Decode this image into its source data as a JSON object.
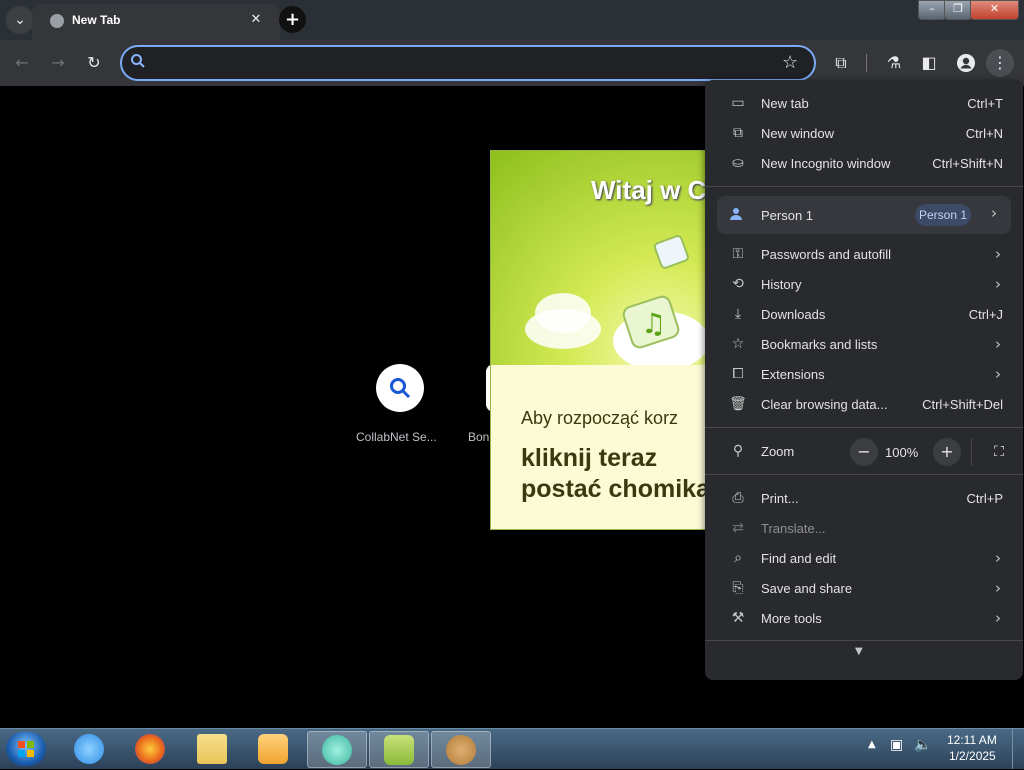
{
  "tab": {
    "title": "New Tab",
    "close": "✕"
  },
  "window_controls": {
    "minimize": "–",
    "maximize": "❐",
    "close": "✕"
  },
  "omnibox": {
    "value": "",
    "placeholder": ""
  },
  "shortcuts": [
    {
      "label": "CollabNet Se...",
      "icon": "search-icon"
    },
    {
      "label": "Boni",
      "icon": "bookmark-icon"
    }
  ],
  "popup": {
    "title": "Witaj w Ch",
    "line1": "Aby rozpocząć korz",
    "line2": "kliknij teraz",
    "line3": "postać chomika"
  },
  "menu": {
    "items_top": [
      {
        "label": "New tab",
        "shortcut": "Ctrl+T",
        "icon": "new-tab-icon"
      },
      {
        "label": "New window",
        "shortcut": "Ctrl+N",
        "icon": "new-window-icon"
      },
      {
        "label": "New Incognito window",
        "shortcut": "Ctrl+Shift+N",
        "icon": "incognito-icon"
      }
    ],
    "person": {
      "label": "Person 1",
      "badge": "Person 1"
    },
    "items_mid": [
      {
        "label": "Passwords and autofill",
        "shortcut": "",
        "submenu": true,
        "icon": "key-icon"
      },
      {
        "label": "History",
        "shortcut": "",
        "submenu": true,
        "icon": "history-icon"
      },
      {
        "label": "Downloads",
        "shortcut": "Ctrl+J",
        "submenu": false,
        "icon": "download-icon"
      },
      {
        "label": "Bookmarks and lists",
        "shortcut": "",
        "submenu": true,
        "icon": "star-icon"
      },
      {
        "label": "Extensions",
        "shortcut": "",
        "submenu": true,
        "icon": "puzzle-icon"
      },
      {
        "label": "Clear browsing data...",
        "shortcut": "Ctrl+Shift+Del",
        "submenu": false,
        "icon": "trash-icon"
      }
    ],
    "zoom": {
      "label": "Zoom",
      "value": "100%",
      "minus": "−",
      "plus": "+"
    },
    "items_bottom": [
      {
        "label": "Print...",
        "shortcut": "Ctrl+P",
        "submenu": false,
        "disabled": false,
        "icon": "print-icon"
      },
      {
        "label": "Translate...",
        "shortcut": "",
        "submenu": false,
        "disabled": true,
        "icon": "translate-icon"
      },
      {
        "label": "Find and edit",
        "shortcut": "",
        "submenu": true,
        "disabled": false,
        "icon": "find-icon"
      },
      {
        "label": "Save and share",
        "shortcut": "",
        "submenu": true,
        "disabled": false,
        "icon": "save-icon"
      },
      {
        "label": "More tools",
        "shortcut": "",
        "submenu": true,
        "disabled": false,
        "icon": "toolbox-icon"
      }
    ]
  },
  "taskbar": {
    "apps": [
      {
        "name": "internet-explorer",
        "color": "#2f8be6",
        "active": false
      },
      {
        "name": "firefox",
        "color": "#e8641b",
        "active": false
      },
      {
        "name": "file-explorer",
        "color": "#e9c45a",
        "active": false
      },
      {
        "name": "media-player",
        "color": "#f0a330",
        "active": false
      },
      {
        "name": "chrome-app",
        "color": "#3fb6a0",
        "active": true
      },
      {
        "name": "hamster-box",
        "color": "#8bbb3a",
        "active": true
      },
      {
        "name": "hamster",
        "color": "#b07a3a",
        "active": true
      }
    ],
    "time": "12:11 AM",
    "date": "1/2/2025"
  }
}
